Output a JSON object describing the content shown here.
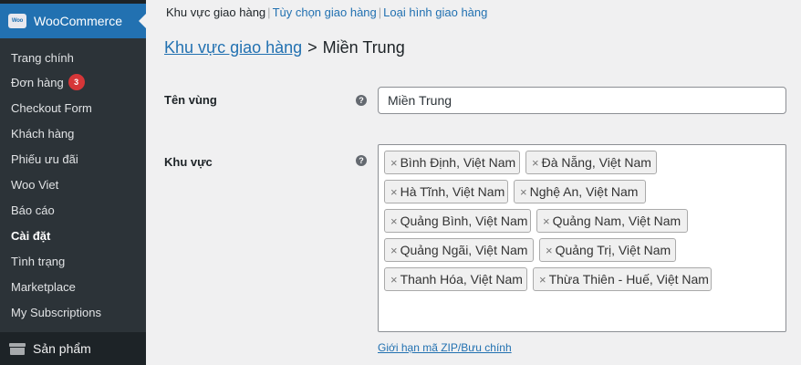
{
  "sidebar": {
    "brand": "WooCommerce",
    "logo_text": "Woo",
    "items": [
      {
        "label": "Trang chính"
      },
      {
        "label": "Đơn hàng",
        "badge": "3"
      },
      {
        "label": "Checkout Form"
      },
      {
        "label": "Khách hàng"
      },
      {
        "label": "Phiếu ưu đãi"
      },
      {
        "label": "Woo Viet"
      },
      {
        "label": "Báo cáo"
      },
      {
        "label": "Cài đặt",
        "current": true
      },
      {
        "label": "Tình trạng"
      },
      {
        "label": "Marketplace"
      },
      {
        "label": "My Subscriptions"
      }
    ],
    "products_label": "Sản phẩm"
  },
  "tabs": {
    "zones": "Khu vực giao hàng",
    "options": "Tùy chọn giao hàng",
    "classes": "Loại hình giao hàng",
    "separator": "|"
  },
  "heading": {
    "breadcrumb": "Khu vực giao hàng",
    "gt": ">",
    "zone": "Miền Trung"
  },
  "form": {
    "name_label": "Tên vùng",
    "name_value": "Miền Trung",
    "region_label": "Khu vực",
    "help_glyph": "?",
    "remove_glyph": "×",
    "regions": [
      "Bình Định, Việt Nam",
      "Đà Nẵng, Việt Nam",
      "Hà Tĩnh, Việt Nam",
      "Nghệ An, Việt Nam",
      "Quảng Bình, Việt Nam",
      "Quảng Nam, Việt Nam",
      "Quảng Ngãi, Việt Nam",
      "Quảng Trị, Việt Nam",
      "Thanh Hóa, Việt Nam",
      "Thừa Thiên - Huế, Việt Nam"
    ],
    "zip_link": "Giới hạn mã ZIP/Bưu chính"
  },
  "colors": {
    "sidebar_bg": "#1d2327",
    "submenu_bg": "#2c3338",
    "accent": "#2271b1",
    "badge": "#d63638",
    "page_bg": "#f0f0f1"
  }
}
